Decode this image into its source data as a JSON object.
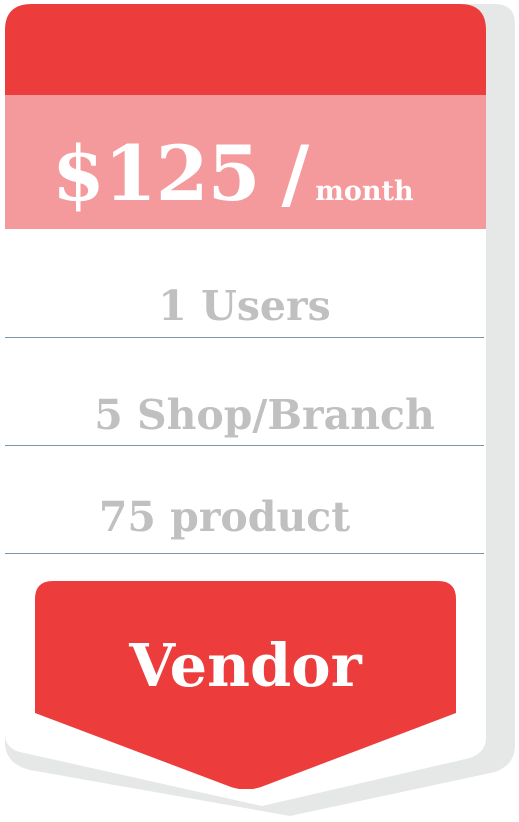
{
  "plan": {
    "price_amount": "$125",
    "price_slash": "/",
    "price_period": "month"
  },
  "features": [
    {
      "label": "1 Users"
    },
    {
      "label": "5 Shop/Branch"
    },
    {
      "label": "75 product"
    }
  ],
  "cta": {
    "label": "Vendor"
  },
  "colors": {
    "accent_red": "#ec3d3c",
    "price_band_pink": "#f59a9c",
    "feature_text_gray": "#c0c0c0",
    "divider_blue_gray": "#7f93ab",
    "card_shadow": "#e6e8e8",
    "card_background": "#ffffff"
  }
}
